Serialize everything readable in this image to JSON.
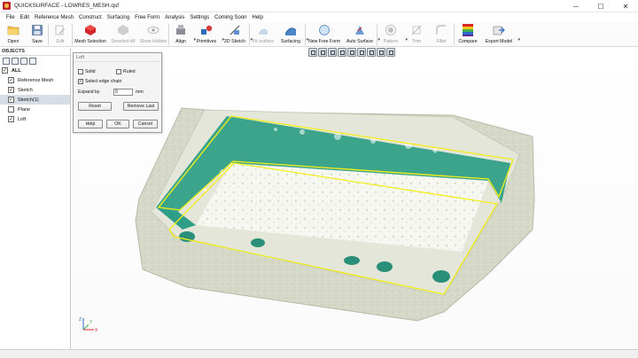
{
  "window": {
    "title": "QUICKSURFACE - LOWRES_MESH.qsf",
    "controls": {
      "minimize": "─",
      "maximize": "☐",
      "close": "✕"
    }
  },
  "menu": [
    "File",
    "Edit",
    "Reference Mesh",
    "Construct",
    "Surfacing",
    "Free Form",
    "Analysis",
    "Settings",
    "Coming Soon",
    "Help"
  ],
  "toolbar": {
    "open": "Open",
    "save": "Save",
    "edit": "Edit",
    "mesh_selection": "Mesh Selection",
    "deselect_all": "Deselect All",
    "show_hidden": "Show Hidden",
    "align": "Align",
    "primitives": "Primitives",
    "sketch_2d": "2D Sketch",
    "fit_surface": "Fit surface",
    "surfacing": "Surfacing",
    "new_free_form": "New Free Form",
    "auto_surface": "Auto Surface",
    "pattern": "Pattern",
    "trim": "Trim",
    "fillet": "Fillet",
    "compare": "Compare",
    "export_model": "Export Model"
  },
  "objects_panel": {
    "header": "OBJECTS",
    "items": [
      {
        "label": "ALL",
        "checked": true,
        "selected": false,
        "indent": 0
      },
      {
        "label": "Reference Mesh",
        "checked": true,
        "selected": false,
        "indent": 1
      },
      {
        "label": "Sketch",
        "checked": true,
        "selected": false,
        "indent": 1
      },
      {
        "label": "Sketch(1)",
        "checked": true,
        "selected": true,
        "indent": 1
      },
      {
        "label": "Plane",
        "checked": false,
        "selected": false,
        "indent": 1
      },
      {
        "label": "Loft",
        "checked": true,
        "selected": false,
        "indent": 1
      }
    ]
  },
  "loft_dialog": {
    "title": "Loft",
    "solid_label": "Solid",
    "ruled_label": "Ruled",
    "select_edge_chain_label": "Select edge chain",
    "select_edge_chain_checked": true,
    "expand_by_label": "Expand by",
    "expand_by_value": "0",
    "expand_unit": "mm",
    "reset_label": "Reset",
    "remove_last_label": "Remove Last",
    "help_label": "Help",
    "ok_label": "OK",
    "cancel_label": "Cancel"
  },
  "axes": {
    "x": "X",
    "y": "Y",
    "z": "Z"
  },
  "colors": {
    "mesh": "#d9dccb",
    "mesh_shadow": "#b9bcaa",
    "surface": "#2f9e86",
    "highlight_curve": "#f2ee1a",
    "accent_red": "#c0262d"
  }
}
